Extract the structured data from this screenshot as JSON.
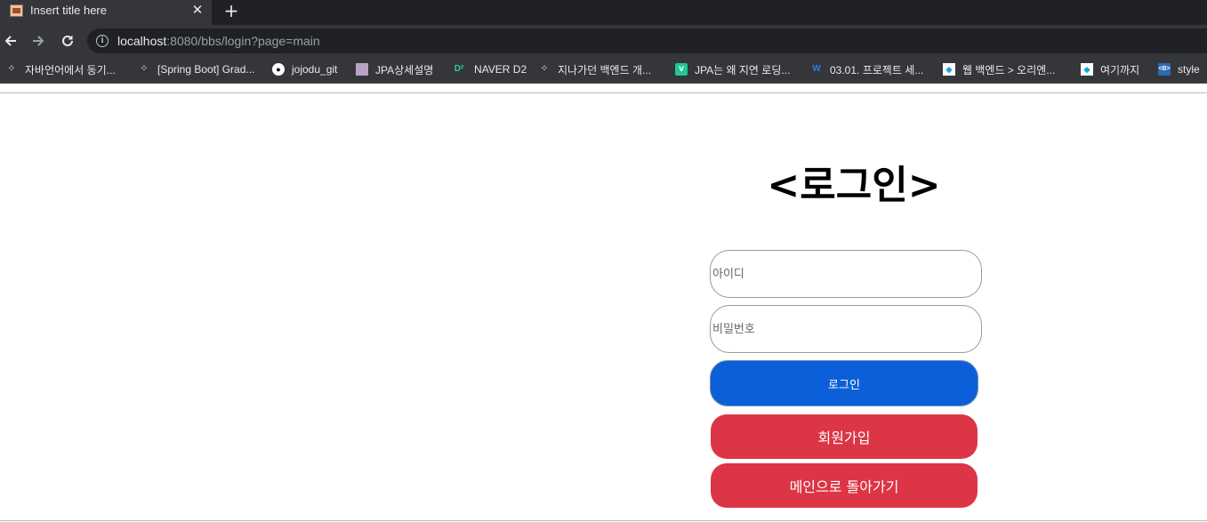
{
  "browser": {
    "tab": {
      "title": "Insert title here",
      "close_label": "✕",
      "new_tab_label": "+"
    },
    "url": {
      "host": "localhost",
      "rest": ":8080/bbs/login?page=main"
    },
    "bookmarks": [
      {
        "label": "자바언어에서 동기...",
        "icon": "tistory-icon"
      },
      {
        "label": "[Spring Boot] Grad...",
        "icon": "tistory-icon"
      },
      {
        "label": "jojodu_git",
        "icon": "github-icon"
      },
      {
        "label": "JPA상세설명",
        "icon": "image-icon"
      },
      {
        "label": "NAVER D2",
        "icon": "naver-d2-icon"
      },
      {
        "label": "지나가던 백엔드 개...",
        "icon": "tistory-icon"
      },
      {
        "label": "JPA는 왜 지연 로딩...",
        "icon": "velog-icon"
      },
      {
        "label": "03.01. 프로젝트 세...",
        "icon": "wikidocs-icon"
      },
      {
        "label": "웹 백엔드 > 오리엔...",
        "icon": "page-icon"
      },
      {
        "label": "여기까지",
        "icon": "page-icon"
      },
      {
        "label": "style",
        "icon": "code-icon"
      }
    ]
  },
  "page": {
    "title": "<로그인>",
    "id_placeholder": "아이디",
    "pw_placeholder": "비밀번호",
    "login_label": "로그인",
    "join_label": "회원가입",
    "main_label": "메인으로 돌아가기"
  },
  "colors": {
    "primary": "#0c5fd8",
    "danger": "#dc3545",
    "chrome_dark": "#35363a"
  }
}
